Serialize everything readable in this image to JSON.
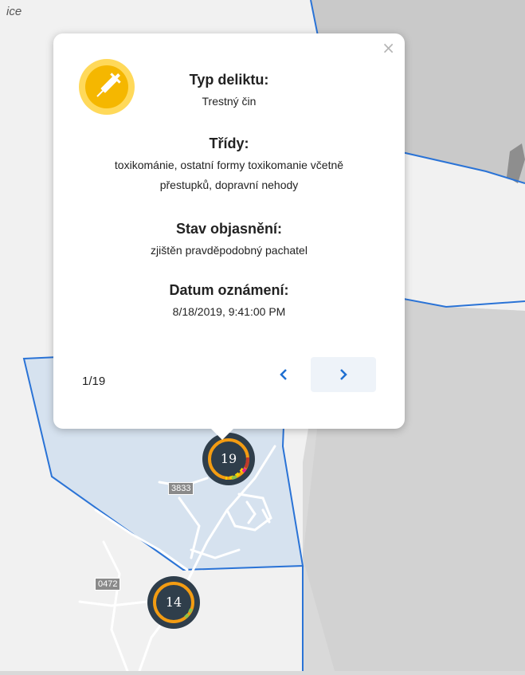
{
  "map": {
    "city_label": "ice",
    "road_labels": [
      "3833",
      "0472"
    ],
    "clusters": [
      {
        "count": "19"
      },
      {
        "count": "14"
      }
    ],
    "colors": {
      "boundary": "#2a73d6",
      "selected_area": "#d6e2ef",
      "cluster_fill": "#2f3e4b",
      "cluster_ring": "#f39c12",
      "accent_green": "#8bc34a",
      "accent_red": "#c0392b",
      "accent_pink": "#e91e8c"
    }
  },
  "popup": {
    "icon": "syringe-icon",
    "close_symbol": "×",
    "fields": [
      {
        "title": "Typ deliktu:",
        "value": "Trestný čin"
      },
      {
        "title": "Třídy:",
        "value": "toxikománie, ostatní formy toxikomanie včetně přestupků, dopravní nehody"
      },
      {
        "title": "Stav objasnění:",
        "value": "zjištěn pravděpodobný pachatel"
      },
      {
        "title": "Datum oznámení:",
        "value": "8/18/2019, 9:41:00 PM"
      }
    ],
    "pager": "1/19",
    "colors": {
      "icon_bg": "#ffd95a",
      "icon_fg": "#f5b700",
      "nav_arrow": "#1f6fd1"
    }
  }
}
